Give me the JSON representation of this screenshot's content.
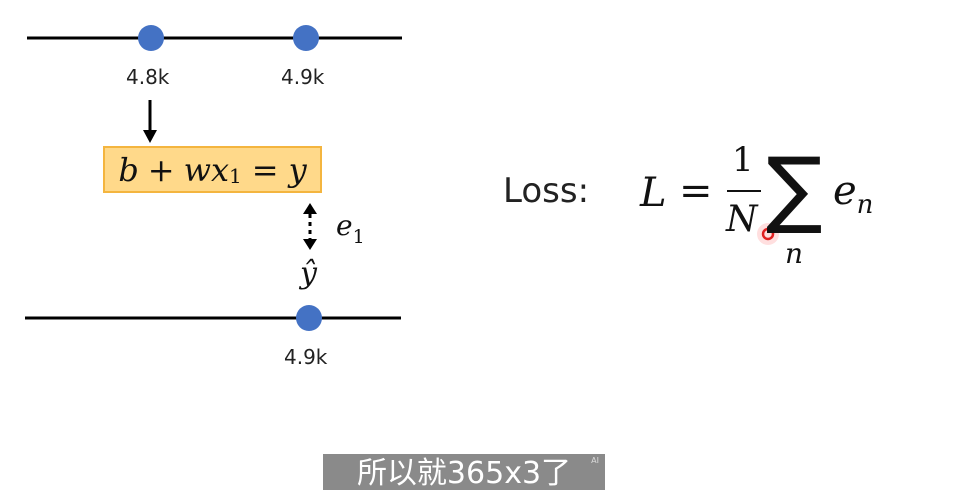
{
  "diagram": {
    "top_line": {
      "points": [
        "4.8k",
        "4.9k"
      ]
    },
    "bottom_line": {
      "points": [
        "4.9k"
      ]
    },
    "equation": {
      "b": "b",
      "plus": "+",
      "w": "w",
      "x": "x",
      "sub": "1",
      "eq": "=",
      "y": "y"
    },
    "error": {
      "e": "e",
      "sub": "1"
    },
    "yhat": "ŷ",
    "colors": {
      "dot": "#4472c4",
      "line": "#000000",
      "box_fill": "#ffd98a",
      "box_border": "#f4b53f"
    }
  },
  "loss": {
    "label": "Loss:",
    "L": "L",
    "eq": "=",
    "numerator": "1",
    "denominator": "N",
    "sigma": "∑",
    "sum_index": "n",
    "term_e": "e",
    "term_sub": "n"
  },
  "subtitle": {
    "text": "所以就365x3了",
    "badge": "AI"
  }
}
